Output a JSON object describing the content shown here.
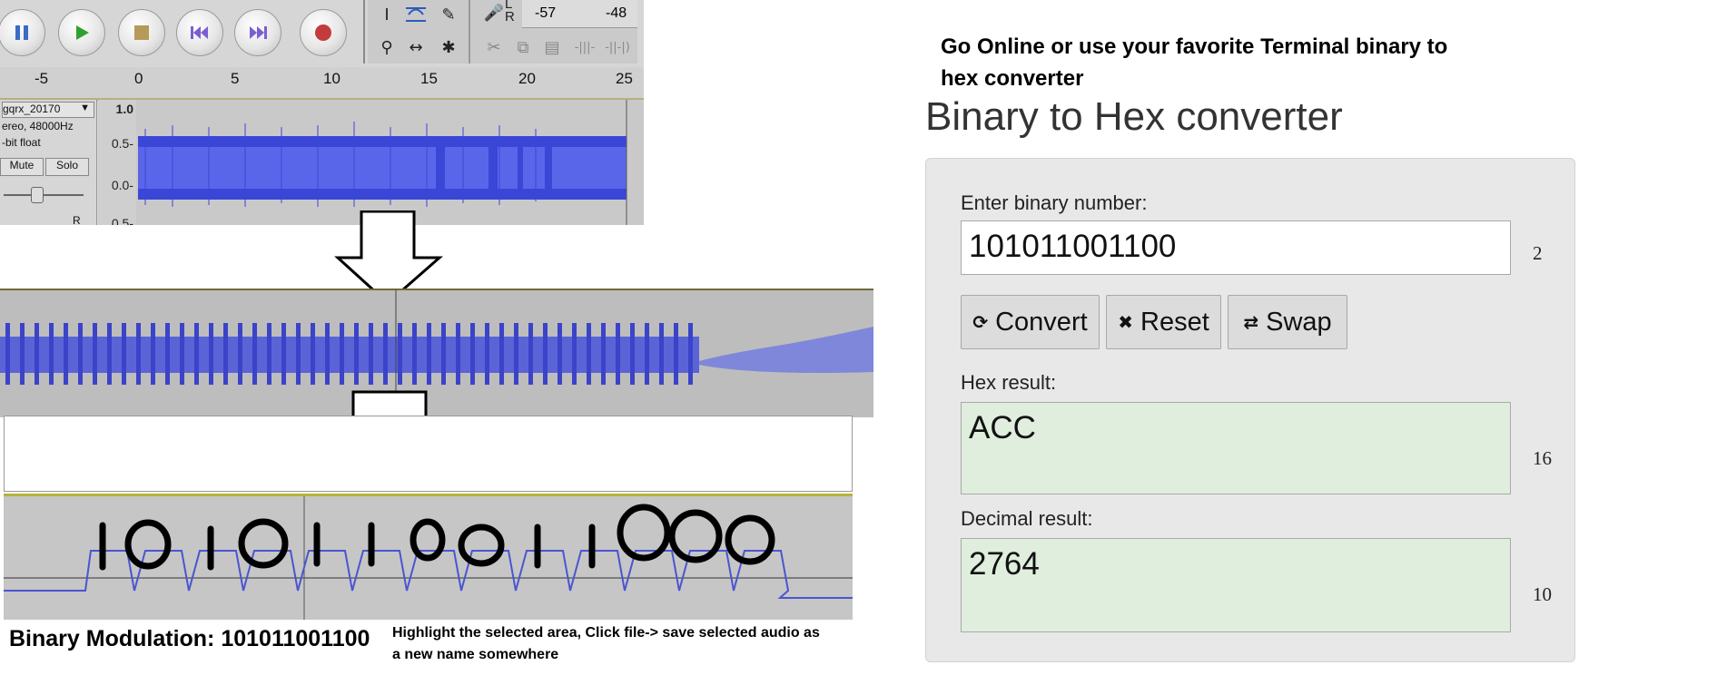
{
  "audacity": {
    "ruler_ticks": [
      "-5",
      "0",
      "5",
      "10",
      "15",
      "20",
      "25"
    ],
    "meter_ticks": [
      "-57",
      "-48"
    ],
    "meter_lr": "L\nR",
    "track": {
      "name": "gqrx_20170",
      "rate": "ereo, 48000Hz",
      "format": "-bit float",
      "mute_label": "Mute",
      "solo_label": "Solo",
      "pan_label": "R"
    },
    "yscale": [
      "1.0",
      "0.5-",
      "0.0-",
      "0.5-"
    ]
  },
  "handwritten_bits": "10101100 1 1000",
  "captions": {
    "binary_modulation": "Binary Modulation: 101011001100",
    "instructions_line1": "Highlight the selected area, Click file-> save selected audio as",
    "instructions_line2": "a new name somewhere"
  },
  "converter": {
    "top_note_line1": "Go Online or use your favorite Terminal binary to",
    "top_note_line2": "hex converter",
    "title": "Binary to Hex converter",
    "binary_label": "Enter binary number:",
    "binary_value": "101011001100",
    "binary_base": "2",
    "buttons": {
      "convert": "Convert",
      "reset": "Reset",
      "swap": "Swap"
    },
    "hex_label": "Hex result:",
    "hex_value": "ACC",
    "hex_base": "16",
    "decimal_label": "Decimal result:",
    "decimal_value": "2764",
    "decimal_base": "10",
    "result_bg": "#dfeedd"
  }
}
